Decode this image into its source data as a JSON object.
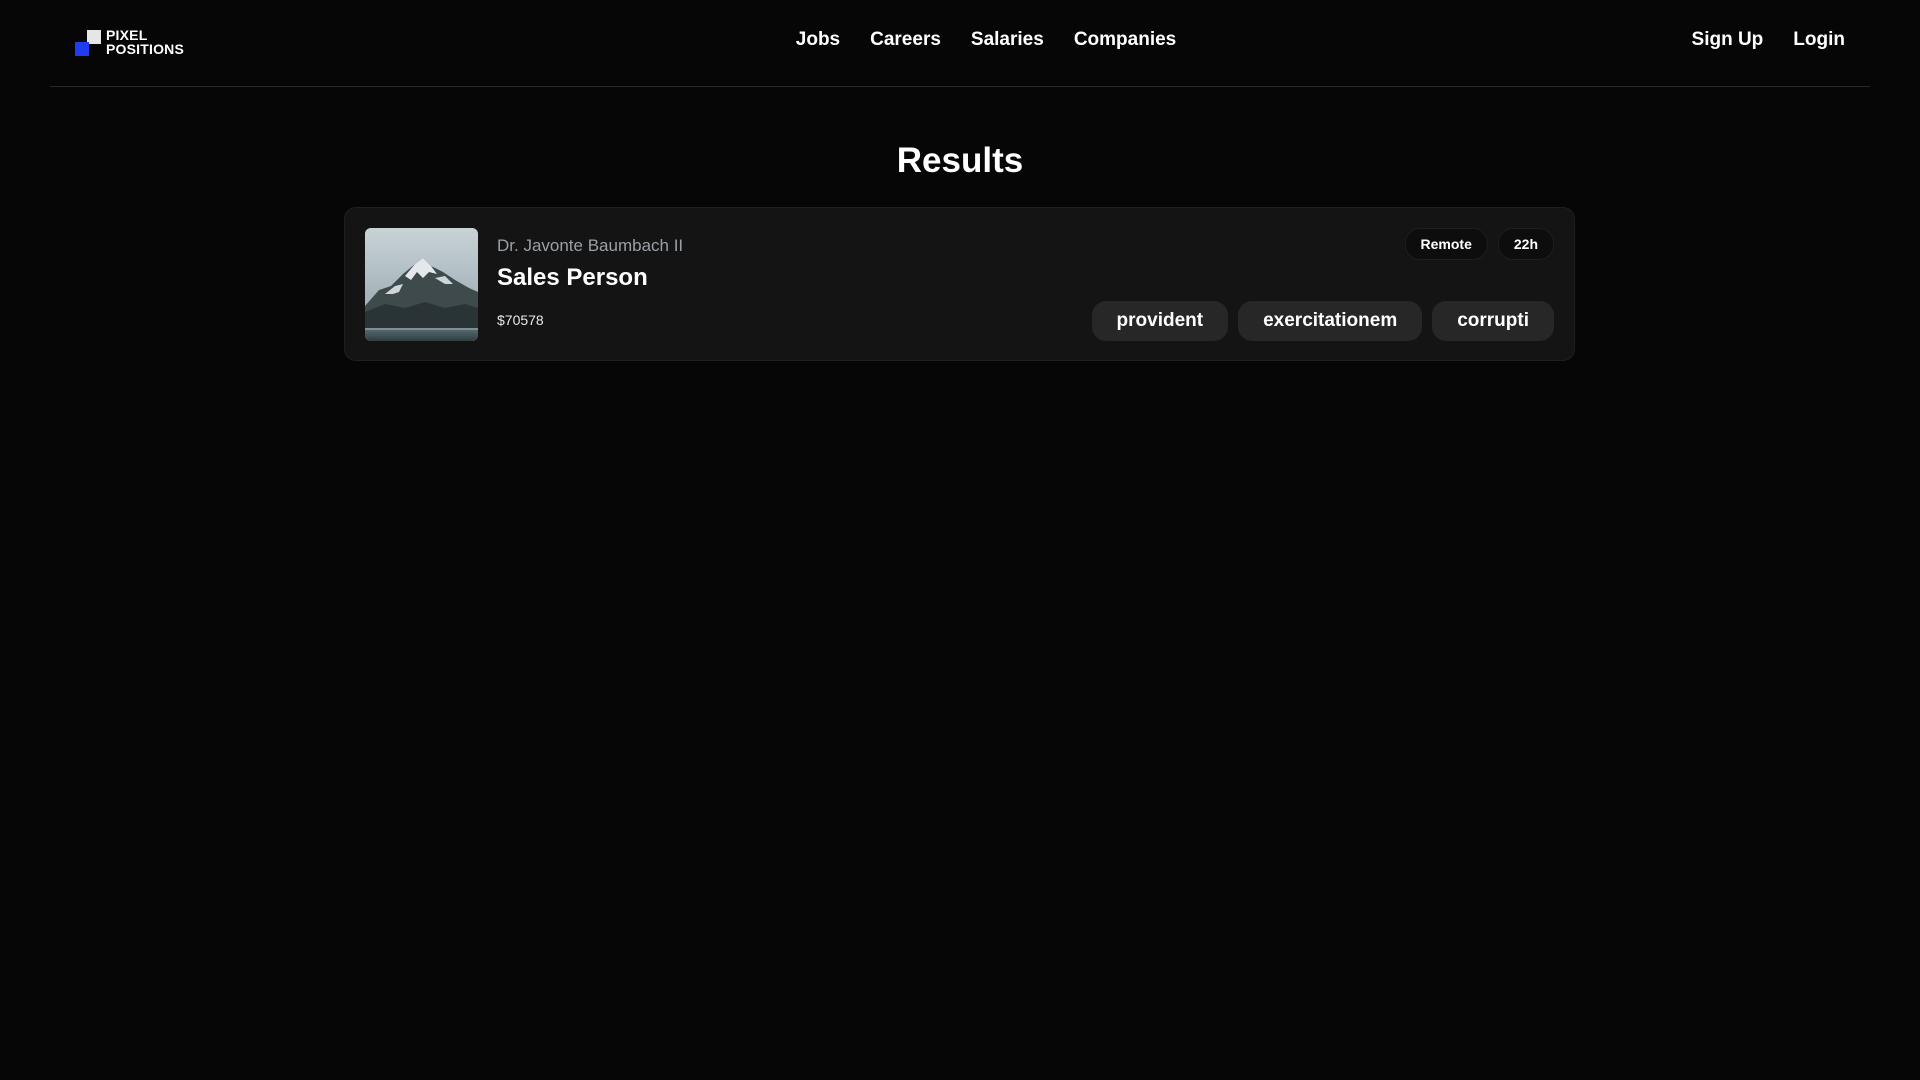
{
  "brand": {
    "logo_line1": "PIXEL",
    "logo_line2": "POSITIONS"
  },
  "nav": {
    "items": [
      {
        "label": "Jobs"
      },
      {
        "label": "Careers"
      },
      {
        "label": "Salaries"
      },
      {
        "label": "Companies"
      }
    ]
  },
  "auth": {
    "signup_label": "Sign Up",
    "login_label": "Login"
  },
  "main": {
    "title": "Results",
    "results": [
      {
        "employer": "Dr. Javonte Baumbach II",
        "title": "Sales Person",
        "salary": "$70578",
        "schedule": "Remote",
        "posted": "22h",
        "tags": [
          "provident",
          "exercitationem",
          "corrupti"
        ]
      }
    ]
  },
  "colors": {
    "background": "#060606",
    "card": "#141414",
    "tag": "#272727",
    "logo_blue": "#1f3cf0"
  }
}
